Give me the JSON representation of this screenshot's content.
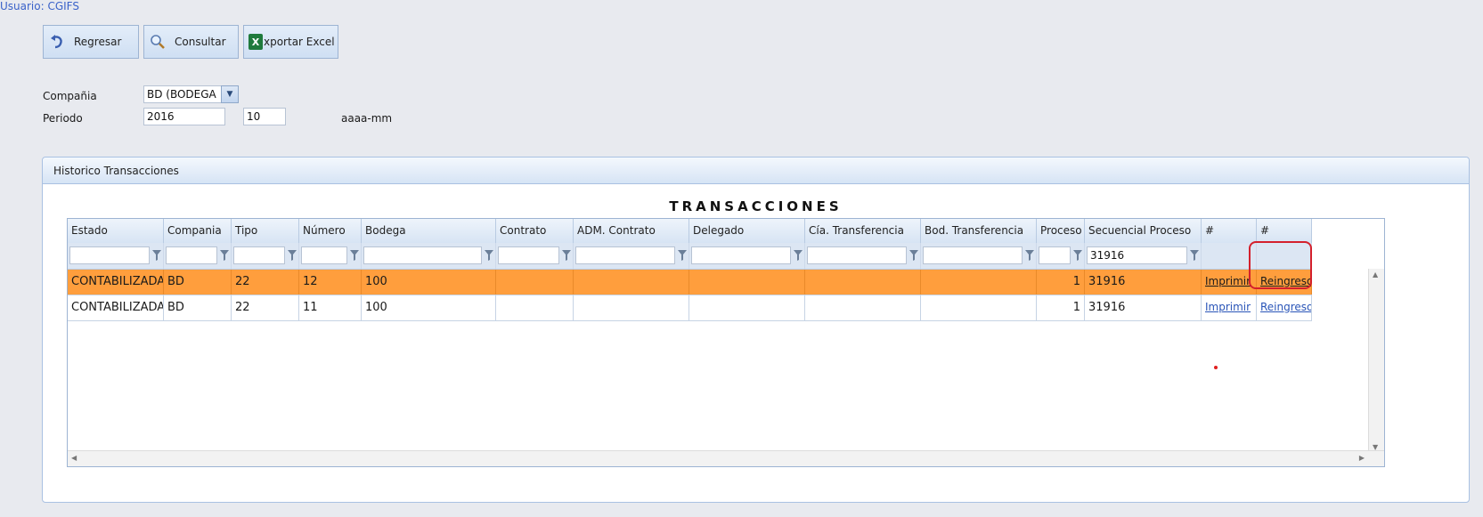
{
  "header": {
    "user": "Usuario: CGIFS"
  },
  "toolbar": {
    "back": "Regresar",
    "query": "Consultar",
    "export": "xportar Excel",
    "export_icon_letter": "X"
  },
  "form": {
    "company_label": "Compañia",
    "company_value": "BD (BODEGA",
    "period_label": "Periodo",
    "year": "2016",
    "month": "10",
    "format_hint": "aaaa-mm"
  },
  "panel": {
    "title": "Historico Transacciones"
  },
  "grid": {
    "title": "TRANSACCIONES",
    "columns": [
      "Estado",
      "Compania",
      "Tipo",
      "Número",
      "Bodega",
      "Contrato",
      "ADM. Contrato",
      "Delegado",
      "Cía. Transferencia",
      "Bod. Transferencia",
      "Proceso",
      "Secuencial Proceso",
      "#",
      "#"
    ],
    "filters": {
      "secuencial": "31916"
    },
    "rows": [
      {
        "estado": "CONTABILIZADA",
        "compania": "BD",
        "tipo": "22",
        "numero": "12",
        "bodega": "100",
        "contrato": "",
        "adm": "",
        "delegado": "",
        "cia": "",
        "bod": "",
        "proceso": "1",
        "secuencial": "31916",
        "print": "Imprimir",
        "reingreso": "Reingreso"
      },
      {
        "estado": "CONTABILIZADA",
        "compania": "BD",
        "tipo": "22",
        "numero": "11",
        "bodega": "100",
        "contrato": "",
        "adm": "",
        "delegado": "",
        "cia": "",
        "bod": "",
        "proceso": "1",
        "secuencial": "31916",
        "print": "Imprimir",
        "reingreso": "Reingreso"
      }
    ]
  },
  "colors": {
    "selected_row": "#ff9e3d",
    "highlight": "#d4202c",
    "link": "#2a55b8"
  },
  "icons": [
    "back-arrow-icon",
    "magnifier-icon",
    "excel-icon",
    "filter-funnel-icon",
    "chevron-down-icon"
  ]
}
